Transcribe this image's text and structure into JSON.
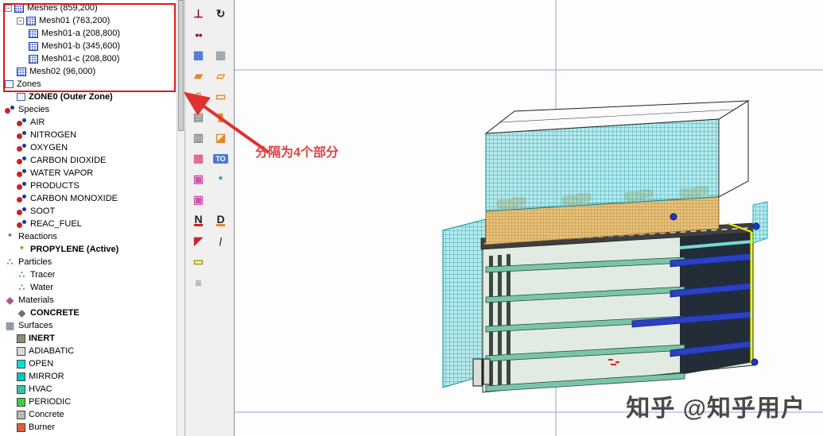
{
  "tree": {
    "items": [
      {
        "label": "Meshes (859,200)",
        "level": 0,
        "icon": "mesh",
        "expander": "minus"
      },
      {
        "label": "Mesh01 (763,200)",
        "level": 1,
        "icon": "mesh",
        "expander": "minus"
      },
      {
        "label": "Mesh01-a (208,800)",
        "level": 2,
        "icon": "mesh"
      },
      {
        "label": "Mesh01-b (345,600)",
        "level": 2,
        "icon": "mesh"
      },
      {
        "label": "Mesh01-c (208,800)",
        "level": 2,
        "icon": "mesh"
      },
      {
        "label": "Mesh02 (96,000)",
        "level": 1,
        "icon": "mesh"
      },
      {
        "label": "Zones",
        "level": 0,
        "icon": "zones"
      },
      {
        "label": "ZONE0 (Outer Zone)",
        "level": 1,
        "icon": "zone",
        "bold": true
      },
      {
        "label": "Species",
        "level": 0,
        "icon": "species"
      },
      {
        "label": "AIR",
        "level": 1,
        "icon": "species"
      },
      {
        "label": "NITROGEN",
        "level": 1,
        "icon": "species"
      },
      {
        "label": "OXYGEN",
        "level": 1,
        "icon": "species"
      },
      {
        "label": "CARBON DIOXIDE",
        "level": 1,
        "icon": "species"
      },
      {
        "label": "WATER VAPOR",
        "level": 1,
        "icon": "species"
      },
      {
        "label": "PRODUCTS",
        "level": 1,
        "icon": "species"
      },
      {
        "label": "CARBON MONOXIDE",
        "level": 1,
        "icon": "species"
      },
      {
        "label": "SOOT",
        "level": 1,
        "icon": "species"
      },
      {
        "label": "REAC_FUEL",
        "level": 1,
        "icon": "species"
      },
      {
        "label": "Reactions",
        "level": 0,
        "icon": "reactions"
      },
      {
        "label": "PROPYLENE (Active)",
        "level": 1,
        "icon": "reaction",
        "bold": true
      },
      {
        "label": "Particles",
        "level": 0,
        "icon": "particles"
      },
      {
        "label": "Tracer",
        "level": 1,
        "icon": "particle"
      },
      {
        "label": "Water",
        "level": 1,
        "icon": "particle"
      },
      {
        "label": "Materials",
        "level": 0,
        "icon": "materials"
      },
      {
        "label": "CONCRETE",
        "level": 1,
        "icon": "material",
        "bold": true
      },
      {
        "label": "Surfaces",
        "level": 0,
        "icon": "surfaces"
      },
      {
        "label": "INERT",
        "level": 1,
        "icon": "chip",
        "color": "#8f8f73",
        "bold": true
      },
      {
        "label": "ADIABATIC",
        "level": 1,
        "icon": "chip",
        "color": "#d9d9d9"
      },
      {
        "label": "OPEN",
        "level": 1,
        "icon": "chip",
        "color": "#00dede"
      },
      {
        "label": "MIRROR",
        "level": 1,
        "icon": "chip",
        "color": "#00c4c4"
      },
      {
        "label": "HVAC",
        "level": 1,
        "icon": "chip",
        "color": "#35c3a5"
      },
      {
        "label": "PERIODIC",
        "level": 1,
        "icon": "chip",
        "color": "#44cc44"
      },
      {
        "label": "Concrete",
        "level": 1,
        "icon": "chip",
        "color": "#b8b8b8"
      },
      {
        "label": "Burner",
        "level": 1,
        "icon": "chip",
        "color": "#e06040"
      }
    ]
  },
  "toolbar": {
    "icons": [
      {
        "name": "pin-icon",
        "glyph": "⊥",
        "color": "#8a0000"
      },
      {
        "name": "rotate-view-icon",
        "glyph": "↻",
        "color": "#222222"
      },
      {
        "name": "spheres-icon",
        "glyph": "●●",
        "color": "#8a1515",
        "small": true
      },
      {
        "name": "spacer"
      },
      {
        "name": "mesh-cube-icon",
        "glyph": "▦",
        "color": "#4a6fd0"
      },
      {
        "name": "grid-table-icon",
        "glyph": "▦",
        "color": "#9aa0a8"
      },
      {
        "name": "slab-icon",
        "glyph": "▰",
        "color": "#e08a2a"
      },
      {
        "name": "slab-outline-icon",
        "glyph": "▱",
        "color": "#e08a2a"
      },
      {
        "name": "wall-icon",
        "glyph": "▯",
        "color": "#e08a2a"
      },
      {
        "name": "box-icon",
        "glyph": "▭",
        "color": "#e08a2a"
      },
      {
        "name": "sheet-icon",
        "glyph": "▤",
        "color": "#8a8a8a"
      },
      {
        "name": "panel-icon",
        "glyph": "▮",
        "color": "#e08a2a"
      },
      {
        "name": "notes-icon",
        "glyph": "▥",
        "color": "#8a8a8a"
      },
      {
        "name": "wedge-icon",
        "glyph": "◪",
        "color": "#e08a2a"
      },
      {
        "name": "vent-grid-icon",
        "glyph": "▦",
        "color": "#e06080"
      },
      {
        "name": "to-label-icon",
        "glyph": "TO",
        "color": "#ffffff",
        "bg": "#4a7ad0"
      },
      {
        "name": "hvac-duct-icon",
        "glyph": "▣",
        "color": "#cc55aa"
      },
      {
        "name": "fan-icon",
        "glyph": "*",
        "color": "#2a9aaa"
      },
      {
        "name": "hvac-node-icon",
        "glyph": "▣",
        "color": "#cc55aa"
      },
      {
        "name": "spacer"
      },
      {
        "name": "new-obstruction-icon",
        "glyph": "N",
        "color": "#222222",
        "underline": "#cc2222"
      },
      {
        "name": "new-hole-icon",
        "glyph": "D",
        "color": "#222222",
        "underline": "#e08a2a"
      },
      {
        "name": "paint-icon",
        "glyph": "◤",
        "color": "#cc2222"
      },
      {
        "name": "probe-icon",
        "glyph": "/",
        "color": "#555555"
      },
      {
        "name": "ruler-icon",
        "glyph": "▭",
        "color": "#b09000"
      },
      {
        "name": "spacer"
      },
      {
        "name": "slider-icon",
        "glyph": "≡",
        "color": "#777777"
      },
      {
        "name": "spacer"
      }
    ]
  },
  "annotation": {
    "text": "分隔为4个部分",
    "color": "#e01818"
  },
  "watermark": {
    "text": "知乎 @知乎用户"
  },
  "colors": {
    "mesh_teal": "#0d9aa6",
    "fire_orange": "#ff9214",
    "slab_blue": "#2940c0",
    "crosshair_blue": "#96a4dc",
    "annotation_red": "#e01818",
    "watermark_gray": "#3a3a3a"
  }
}
